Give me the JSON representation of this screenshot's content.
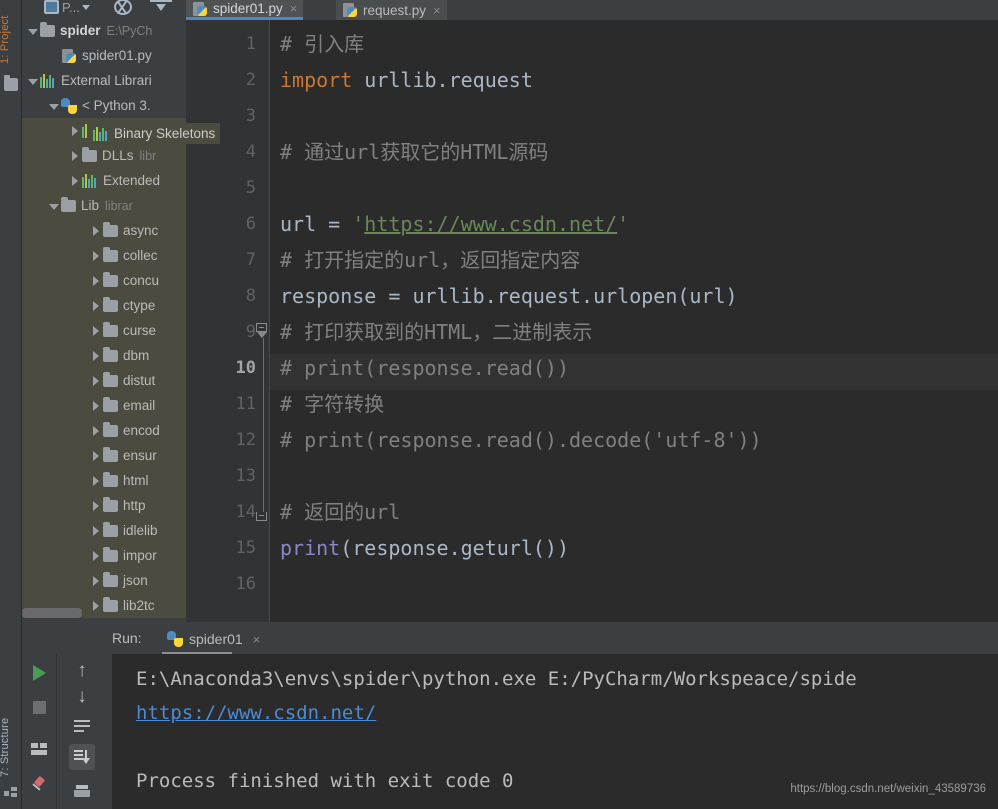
{
  "app": {
    "left_tabs": [
      {
        "label": "1: Project",
        "icon": "folder-icon"
      },
      {
        "label": "7: Structure",
        "icon": "structure-icon"
      }
    ]
  },
  "toolbar": {
    "project_selector_label": "P...",
    "icons": [
      "module-icon",
      "chevron-down-icon",
      "steering-wheel-icon",
      "collapse-all-icon"
    ]
  },
  "project_tree": {
    "items": [
      {
        "label": "spider",
        "hint": "E:\\PyCh",
        "indent": 0,
        "arrow": "down",
        "icon": "folder-icon",
        "bold": true,
        "selected": false
      },
      {
        "label": "spider01.py",
        "hint": "",
        "indent": 1,
        "arrow": "none",
        "icon": "python-file-icon",
        "bold": false,
        "selected": false
      },
      {
        "label": "External Librari",
        "hint": "",
        "indent": 0,
        "arrow": "down",
        "icon": "library-icon",
        "bold": false,
        "selected": false
      },
      {
        "label": "< Python 3.",
        "hint": "",
        "indent": 1,
        "arrow": "down",
        "icon": "python-icon",
        "bold": false,
        "selected": false
      },
      {
        "label": "Binary Skeletons",
        "hint": "",
        "indent": 2,
        "arrow": "right",
        "icon": "library-icon",
        "bold": false,
        "selected": true
      },
      {
        "label": "DLLs",
        "hint": "libr",
        "indent": 2,
        "arrow": "right",
        "icon": "folder-icon",
        "bold": false,
        "selected": true
      },
      {
        "label": "Extended",
        "hint": "",
        "indent": 2,
        "arrow": "right",
        "icon": "library-icon",
        "bold": false,
        "selected": true
      },
      {
        "label": "Lib",
        "hint": "librar",
        "indent": 1,
        "arrow": "down",
        "icon": "folder-icon",
        "bold": false,
        "selected": true
      },
      {
        "label": "async",
        "hint": "",
        "indent": 3,
        "arrow": "right",
        "icon": "folder-icon",
        "bold": false,
        "selected": true
      },
      {
        "label": "collec",
        "hint": "",
        "indent": 3,
        "arrow": "right",
        "icon": "folder-icon",
        "bold": false,
        "selected": true
      },
      {
        "label": "concu",
        "hint": "",
        "indent": 3,
        "arrow": "right",
        "icon": "folder-icon",
        "bold": false,
        "selected": true
      },
      {
        "label": "ctype",
        "hint": "",
        "indent": 3,
        "arrow": "right",
        "icon": "folder-icon",
        "bold": false,
        "selected": true
      },
      {
        "label": "curse",
        "hint": "",
        "indent": 3,
        "arrow": "right",
        "icon": "folder-icon",
        "bold": false,
        "selected": true
      },
      {
        "label": "dbm",
        "hint": "",
        "indent": 3,
        "arrow": "right",
        "icon": "folder-icon",
        "bold": false,
        "selected": true
      },
      {
        "label": "distut",
        "hint": "",
        "indent": 3,
        "arrow": "right",
        "icon": "folder-icon",
        "bold": false,
        "selected": true
      },
      {
        "label": "email",
        "hint": "",
        "indent": 3,
        "arrow": "right",
        "icon": "folder-icon",
        "bold": false,
        "selected": true
      },
      {
        "label": "encod",
        "hint": "",
        "indent": 3,
        "arrow": "right",
        "icon": "folder-icon",
        "bold": false,
        "selected": true
      },
      {
        "label": "ensur",
        "hint": "",
        "indent": 3,
        "arrow": "right",
        "icon": "folder-icon",
        "bold": false,
        "selected": true
      },
      {
        "label": "html",
        "hint": "",
        "indent": 3,
        "arrow": "right",
        "icon": "folder-icon",
        "bold": false,
        "selected": true
      },
      {
        "label": "http",
        "hint": "",
        "indent": 3,
        "arrow": "right",
        "icon": "folder-icon",
        "bold": false,
        "selected": true
      },
      {
        "label": "idlelib",
        "hint": "",
        "indent": 3,
        "arrow": "right",
        "icon": "folder-icon",
        "bold": false,
        "selected": true
      },
      {
        "label": "impor",
        "hint": "",
        "indent": 3,
        "arrow": "right",
        "icon": "folder-icon",
        "bold": false,
        "selected": true
      },
      {
        "label": "json",
        "hint": "",
        "indent": 3,
        "arrow": "right",
        "icon": "folder-icon",
        "bold": false,
        "selected": true
      },
      {
        "label": "lib2tc",
        "hint": "",
        "indent": 3,
        "arrow": "right",
        "icon": "folder-icon",
        "bold": false,
        "selected": true
      }
    ],
    "hover_tooltip": "Binary Skeletons"
  },
  "editor": {
    "tabs": [
      {
        "label": "spider01.py",
        "active": true,
        "close": "×"
      },
      {
        "label": "request.py",
        "active": false,
        "close": "×"
      }
    ],
    "current_line": 10,
    "line_numbers": [
      "1",
      "2",
      "3",
      "4",
      "5",
      "6",
      "7",
      "8",
      "9",
      "10",
      "11",
      "12",
      "13",
      "14",
      "15",
      "16"
    ],
    "lines": [
      {
        "n": 1,
        "segments": [
          {
            "t": "# 引入库",
            "c": "cmt"
          }
        ]
      },
      {
        "n": 2,
        "segments": [
          {
            "t": "import",
            "c": "kw"
          },
          {
            "t": " urllib.request",
            "c": "plain"
          }
        ]
      },
      {
        "n": 3,
        "segments": []
      },
      {
        "n": 4,
        "segments": [
          {
            "t": "# 通过url获取它的HTML源码",
            "c": "cmt"
          }
        ]
      },
      {
        "n": 5,
        "segments": []
      },
      {
        "n": 6,
        "segments": [
          {
            "t": "url = ",
            "c": "plain"
          },
          {
            "t": "'",
            "c": "str"
          },
          {
            "t": "https://www.csdn.net/",
            "c": "str-url"
          },
          {
            "t": "'",
            "c": "str"
          }
        ]
      },
      {
        "n": 7,
        "segments": [
          {
            "t": "# 打开指定的url，返回指定内容",
            "c": "cmt"
          }
        ]
      },
      {
        "n": 8,
        "segments": [
          {
            "t": "response = urllib.request.urlopen(url)",
            "c": "plain"
          }
        ]
      },
      {
        "n": 9,
        "segments": [
          {
            "t": "# 打印获取到的HTML，二进制表示",
            "c": "cmt"
          }
        ]
      },
      {
        "n": 10,
        "segments": [
          {
            "t": "# print(response.read())",
            "c": "cmt"
          }
        ]
      },
      {
        "n": 11,
        "segments": [
          {
            "t": "# 字符转换",
            "c": "cmt"
          }
        ]
      },
      {
        "n": 12,
        "segments": [
          {
            "t": "# print(response.read().decode('utf-8'))",
            "c": "cmt"
          }
        ]
      },
      {
        "n": 13,
        "segments": []
      },
      {
        "n": 14,
        "segments": [
          {
            "t": "# 返回的url",
            "c": "cmt"
          }
        ]
      },
      {
        "n": 15,
        "segments": [
          {
            "t": "print",
            "c": "fn"
          },
          {
            "t": "(response.geturl())",
            "c": "plain"
          }
        ]
      },
      {
        "n": 16,
        "segments": []
      }
    ]
  },
  "run_panel": {
    "title": "Run:",
    "tab_label": "spider01",
    "tab_close": "×",
    "buttons": [
      {
        "name": "run-button",
        "icon": "play-icon"
      },
      {
        "name": "stop-button",
        "icon": "stop-icon"
      },
      {
        "name": "layout-button",
        "icon": "grid-icon"
      },
      {
        "name": "pin-button",
        "icon": "pin-icon"
      },
      {
        "name": "up-button",
        "icon": "arrow-up-icon"
      },
      {
        "name": "down-button",
        "icon": "arrow-down-icon"
      },
      {
        "name": "soft-wrap-button",
        "icon": "wrap-icon"
      },
      {
        "name": "scroll-to-end-button",
        "icon": "scroll-to-end-icon"
      },
      {
        "name": "print-button",
        "icon": "print-icon"
      }
    ],
    "console": [
      {
        "text": "E:\\Anaconda3\\envs\\spider\\python.exe E:/PyCharm/Workspeace/spide",
        "style": "white"
      },
      {
        "text": "https://www.csdn.net/",
        "style": "link"
      },
      {
        "text": "",
        "style": "white"
      },
      {
        "text": "Process finished with exit code 0",
        "style": "white"
      }
    ]
  },
  "watermark": "https://blog.csdn.net/weixin_43589736",
  "colors": {
    "panel_bg": "#3c3f41",
    "editor_bg": "#2b2b2b",
    "gutter_bg": "#313335",
    "selection_bg": "#4b4b3f",
    "active_tab_underline": "#4a88c7",
    "comment": "#808080",
    "keyword": "#cc7832",
    "string": "#6a8759",
    "function": "#8888c6",
    "link": "#4a8bd4",
    "run_green": "#499c54"
  }
}
